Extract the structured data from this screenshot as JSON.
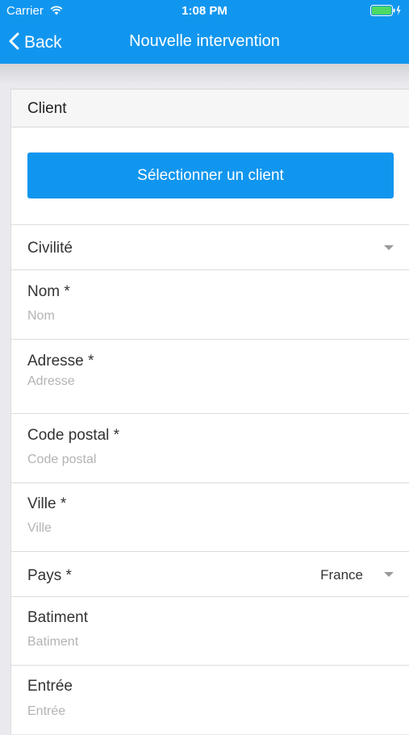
{
  "status_bar": {
    "carrier": "Carrier",
    "time": "1:08 PM"
  },
  "nav": {
    "back_label": "Back",
    "title": "Nouvelle intervention"
  },
  "client_section": {
    "title": "Client",
    "select_button_label": "Sélectionner un client"
  },
  "form": {
    "civilite": {
      "label": "Civilité"
    },
    "nom": {
      "label": "Nom *",
      "placeholder": "Nom",
      "value": ""
    },
    "adresse": {
      "label": "Adresse *",
      "placeholder": "Adresse",
      "value": ""
    },
    "code_postal": {
      "label": "Code postal *",
      "placeholder": "Code postal",
      "value": ""
    },
    "ville": {
      "label": "Ville *",
      "placeholder": "Ville",
      "value": ""
    },
    "pays": {
      "label": "Pays *",
      "value": "France"
    },
    "batiment": {
      "label": "Batiment",
      "placeholder": "Batiment",
      "value": ""
    },
    "entree": {
      "label": "Entrée",
      "placeholder": "Entrée",
      "value": ""
    }
  },
  "colors": {
    "accent": "#1196ef",
    "background": "#e9e9ee",
    "placeholder": "#b3b3b3"
  }
}
